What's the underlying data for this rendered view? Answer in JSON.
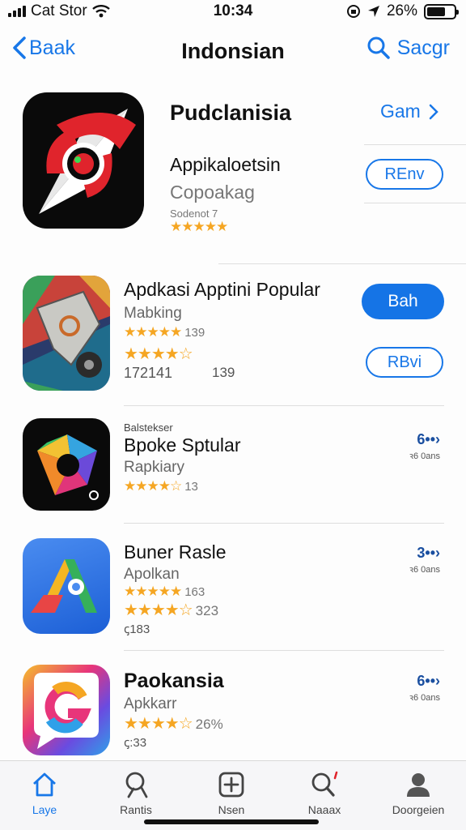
{
  "status_bar": {
    "carrier": "Cat Stor",
    "time": "10:34",
    "battery": "26%",
    "battery_level": 0.7
  },
  "nav": {
    "back_label": "Baak",
    "title": "Indonsian",
    "search_label": "Sacgr"
  },
  "featured": {
    "name": "Pudclanisia",
    "subtitle": "Appikaloetsin",
    "category": "Copoakag",
    "rating_label": "Sodenot 7",
    "stars": "★★★★★",
    "get_label": "Gam",
    "button_label": "REnv"
  },
  "apps": [
    {
      "name": "Apdkasi Apptini Popular",
      "category": "Mabking",
      "stars1": "★★★★★",
      "count1": "139",
      "stars2": "★★★★☆",
      "extra": "172141",
      "extra2": "139",
      "button_primary": "Bah",
      "button_secondary": "RBvi"
    },
    {
      "overline": "Balstekser",
      "name": "Bpoke Sptular",
      "category": "Rapkiary",
      "stars1": "★★★★☆",
      "count1": "13",
      "action_big": "6••›",
      "action_small": "ꝛ6 0ans"
    },
    {
      "name": "Buner Rasle",
      "category": "Apolkan",
      "stars1": "★★★★★",
      "count1": "163",
      "stars2": "★★★★☆",
      "count2": "323",
      "extra": "ꞔ183",
      "action_big": "3••›",
      "action_small": "ꝛ6 0ans"
    },
    {
      "name": "Paokansia",
      "category": "Apkkarr",
      "stars1": "★★★★☆",
      "count1": "26%",
      "extra": "ꞔ:33",
      "action_big": "6••›",
      "action_small": "ꝛ6 0ans"
    }
  ],
  "tabs": [
    {
      "label": "Laye",
      "icon": "home-icon"
    },
    {
      "label": "Rantis",
      "icon": "search-icon"
    },
    {
      "label": "Nsen",
      "icon": "plus-square-icon"
    },
    {
      "label": "Naaax",
      "icon": "search-alert-icon"
    },
    {
      "label": "Doorgeien",
      "icon": "person-icon"
    }
  ],
  "colors": {
    "accent": "#1877e8",
    "star": "#f5a623",
    "button_fill": "#1574e6"
  }
}
